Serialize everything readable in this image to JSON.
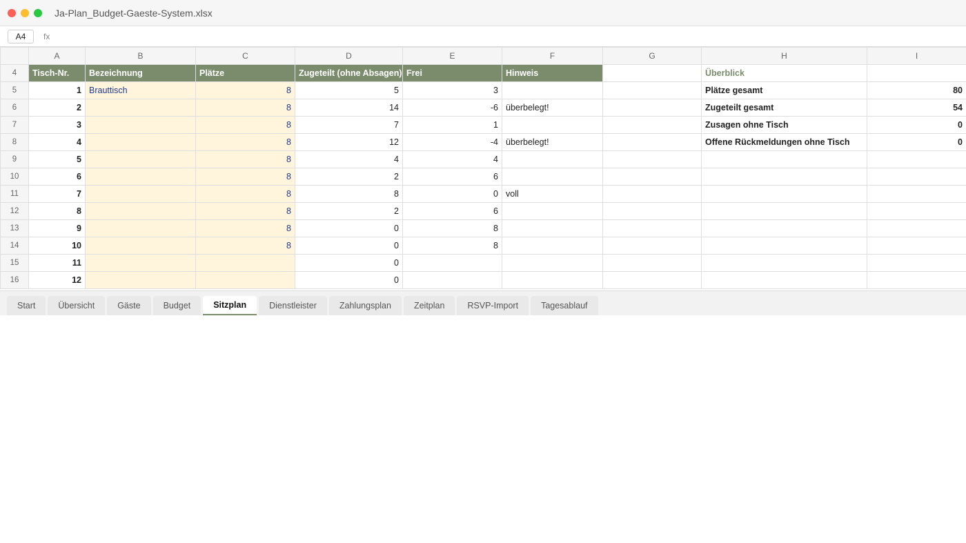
{
  "window": {
    "title": "Ja-Plan_Budget-Gaeste-System.xlsx"
  },
  "formula_bar": {
    "cell_ref": "A4",
    "fx": "fx",
    "value": ""
  },
  "columns": [
    "A",
    "B",
    "C",
    "D",
    "E",
    "F",
    "G",
    "H",
    "I"
  ],
  "header_row": {
    "row": "4",
    "A": "Tisch-Nr.",
    "B": "Bezeichnung",
    "C": "Plätze",
    "D": "Zugeteilt (ohne Absagen)",
    "E": "Frei",
    "F": "Hinweis",
    "H": "Überblick"
  },
  "rows": [
    {
      "row": "5",
      "A": "1",
      "B": "Brauttisch",
      "C": "8",
      "D": "5",
      "E": "3",
      "F": "",
      "H": "Plätze gesamt",
      "I": "80"
    },
    {
      "row": "6",
      "A": "2",
      "B": "",
      "C": "8",
      "D": "14",
      "E": "-6",
      "F": "überbelegt!",
      "H": "Zugeteilt gesamt",
      "I": "54"
    },
    {
      "row": "7",
      "A": "3",
      "B": "",
      "C": "8",
      "D": "7",
      "E": "1",
      "F": "",
      "H": "Zusagen ohne Tisch",
      "I": "0"
    },
    {
      "row": "8",
      "A": "4",
      "B": "",
      "C": "8",
      "D": "12",
      "E": "-4",
      "F": "überbelegt!",
      "H": "Offene Rückmeldungen ohne Tisch",
      "I": "0"
    },
    {
      "row": "9",
      "A": "5",
      "B": "",
      "C": "8",
      "D": "4",
      "E": "4",
      "F": "",
      "H": "",
      "I": ""
    },
    {
      "row": "10",
      "A": "6",
      "B": "",
      "C": "8",
      "D": "2",
      "E": "6",
      "F": "",
      "H": "",
      "I": ""
    },
    {
      "row": "11",
      "A": "7",
      "B": "",
      "C": "8",
      "D": "8",
      "E": "0",
      "F": "voll",
      "H": "",
      "I": ""
    },
    {
      "row": "12",
      "A": "8",
      "B": "",
      "C": "8",
      "D": "2",
      "E": "6",
      "F": "",
      "H": "",
      "I": ""
    },
    {
      "row": "13",
      "A": "9",
      "B": "",
      "C": "8",
      "D": "0",
      "E": "8",
      "F": "",
      "H": "",
      "I": ""
    },
    {
      "row": "14",
      "A": "10",
      "B": "",
      "C": "8",
      "D": "0",
      "E": "8",
      "F": "",
      "H": "",
      "I": ""
    },
    {
      "row": "15",
      "A": "11",
      "B": "",
      "C": "",
      "D": "0",
      "E": "",
      "F": "",
      "H": "",
      "I": ""
    },
    {
      "row": "16",
      "A": "12",
      "B": "",
      "C": "",
      "D": "0",
      "E": "",
      "F": "",
      "H": "",
      "I": ""
    }
  ],
  "sheet_tabs": [
    {
      "label": "Start"
    },
    {
      "label": "Übersicht"
    },
    {
      "label": "Gäste"
    },
    {
      "label": "Budget"
    },
    {
      "label": "Sitzplan",
      "active": true
    },
    {
      "label": "Dienstleister"
    },
    {
      "label": "Zahlungsplan"
    },
    {
      "label": "Zeitplan"
    },
    {
      "label": "RSVP-Import"
    },
    {
      "label": "Tagesablauf"
    }
  ],
  "colors": {
    "header_bg": "#7a8c6c",
    "input_bg": "#fff4dc",
    "input_text": "#1f3a8a",
    "traffic_red": "#fe5f57",
    "traffic_yellow": "#febc2e",
    "traffic_green": "#28c840"
  }
}
